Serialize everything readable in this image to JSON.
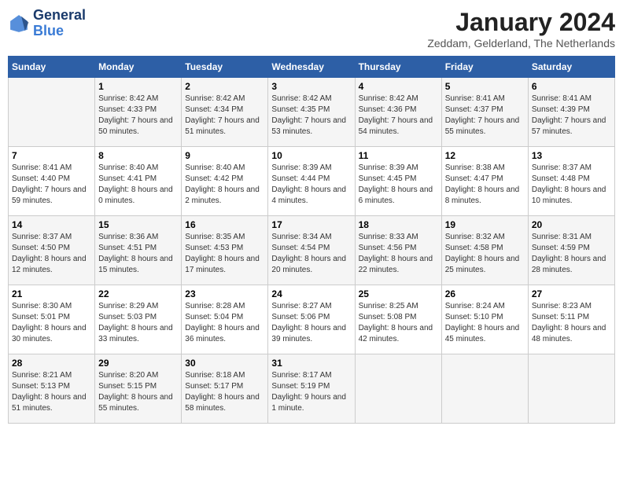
{
  "header": {
    "logo": {
      "line1": "General",
      "line2": "Blue"
    },
    "title": "January 2024",
    "location": "Zeddam, Gelderland, The Netherlands"
  },
  "columns": [
    "Sunday",
    "Monday",
    "Tuesday",
    "Wednesday",
    "Thursday",
    "Friday",
    "Saturday"
  ],
  "weeks": [
    [
      {
        "day": "",
        "sunrise": "",
        "sunset": "",
        "daylight": ""
      },
      {
        "day": "1",
        "sunrise": "8:42 AM",
        "sunset": "4:33 PM",
        "daylight": "7 hours and 50 minutes."
      },
      {
        "day": "2",
        "sunrise": "8:42 AM",
        "sunset": "4:34 PM",
        "daylight": "7 hours and 51 minutes."
      },
      {
        "day": "3",
        "sunrise": "8:42 AM",
        "sunset": "4:35 PM",
        "daylight": "7 hours and 53 minutes."
      },
      {
        "day": "4",
        "sunrise": "8:42 AM",
        "sunset": "4:36 PM",
        "daylight": "7 hours and 54 minutes."
      },
      {
        "day": "5",
        "sunrise": "8:41 AM",
        "sunset": "4:37 PM",
        "daylight": "7 hours and 55 minutes."
      },
      {
        "day": "6",
        "sunrise": "8:41 AM",
        "sunset": "4:39 PM",
        "daylight": "7 hours and 57 minutes."
      }
    ],
    [
      {
        "day": "7",
        "sunrise": "8:41 AM",
        "sunset": "4:40 PM",
        "daylight": "7 hours and 59 minutes."
      },
      {
        "day": "8",
        "sunrise": "8:40 AM",
        "sunset": "4:41 PM",
        "daylight": "8 hours and 0 minutes."
      },
      {
        "day": "9",
        "sunrise": "8:40 AM",
        "sunset": "4:42 PM",
        "daylight": "8 hours and 2 minutes."
      },
      {
        "day": "10",
        "sunrise": "8:39 AM",
        "sunset": "4:44 PM",
        "daylight": "8 hours and 4 minutes."
      },
      {
        "day": "11",
        "sunrise": "8:39 AM",
        "sunset": "4:45 PM",
        "daylight": "8 hours and 6 minutes."
      },
      {
        "day": "12",
        "sunrise": "8:38 AM",
        "sunset": "4:47 PM",
        "daylight": "8 hours and 8 minutes."
      },
      {
        "day": "13",
        "sunrise": "8:37 AM",
        "sunset": "4:48 PM",
        "daylight": "8 hours and 10 minutes."
      }
    ],
    [
      {
        "day": "14",
        "sunrise": "8:37 AM",
        "sunset": "4:50 PM",
        "daylight": "8 hours and 12 minutes."
      },
      {
        "day": "15",
        "sunrise": "8:36 AM",
        "sunset": "4:51 PM",
        "daylight": "8 hours and 15 minutes."
      },
      {
        "day": "16",
        "sunrise": "8:35 AM",
        "sunset": "4:53 PM",
        "daylight": "8 hours and 17 minutes."
      },
      {
        "day": "17",
        "sunrise": "8:34 AM",
        "sunset": "4:54 PM",
        "daylight": "8 hours and 20 minutes."
      },
      {
        "day": "18",
        "sunrise": "8:33 AM",
        "sunset": "4:56 PM",
        "daylight": "8 hours and 22 minutes."
      },
      {
        "day": "19",
        "sunrise": "8:32 AM",
        "sunset": "4:58 PM",
        "daylight": "8 hours and 25 minutes."
      },
      {
        "day": "20",
        "sunrise": "8:31 AM",
        "sunset": "4:59 PM",
        "daylight": "8 hours and 28 minutes."
      }
    ],
    [
      {
        "day": "21",
        "sunrise": "8:30 AM",
        "sunset": "5:01 PM",
        "daylight": "8 hours and 30 minutes."
      },
      {
        "day": "22",
        "sunrise": "8:29 AM",
        "sunset": "5:03 PM",
        "daylight": "8 hours and 33 minutes."
      },
      {
        "day": "23",
        "sunrise": "8:28 AM",
        "sunset": "5:04 PM",
        "daylight": "8 hours and 36 minutes."
      },
      {
        "day": "24",
        "sunrise": "8:27 AM",
        "sunset": "5:06 PM",
        "daylight": "8 hours and 39 minutes."
      },
      {
        "day": "25",
        "sunrise": "8:25 AM",
        "sunset": "5:08 PM",
        "daylight": "8 hours and 42 minutes."
      },
      {
        "day": "26",
        "sunrise": "8:24 AM",
        "sunset": "5:10 PM",
        "daylight": "8 hours and 45 minutes."
      },
      {
        "day": "27",
        "sunrise": "8:23 AM",
        "sunset": "5:11 PM",
        "daylight": "8 hours and 48 minutes."
      }
    ],
    [
      {
        "day": "28",
        "sunrise": "8:21 AM",
        "sunset": "5:13 PM",
        "daylight": "8 hours and 51 minutes."
      },
      {
        "day": "29",
        "sunrise": "8:20 AM",
        "sunset": "5:15 PM",
        "daylight": "8 hours and 55 minutes."
      },
      {
        "day": "30",
        "sunrise": "8:18 AM",
        "sunset": "5:17 PM",
        "daylight": "8 hours and 58 minutes."
      },
      {
        "day": "31",
        "sunrise": "8:17 AM",
        "sunset": "5:19 PM",
        "daylight": "9 hours and 1 minute."
      },
      {
        "day": "",
        "sunrise": "",
        "sunset": "",
        "daylight": ""
      },
      {
        "day": "",
        "sunrise": "",
        "sunset": "",
        "daylight": ""
      },
      {
        "day": "",
        "sunrise": "",
        "sunset": "",
        "daylight": ""
      }
    ]
  ]
}
